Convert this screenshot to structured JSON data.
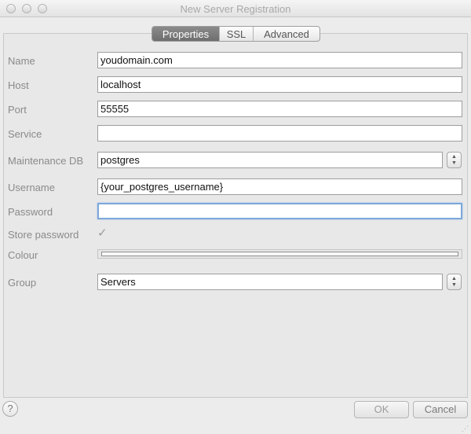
{
  "window": {
    "title": "New Server Registration"
  },
  "tabs": [
    {
      "label": "Properties",
      "active": true
    },
    {
      "label": "SSL",
      "active": false
    },
    {
      "label": "Advanced",
      "active": false
    }
  ],
  "form": {
    "name": {
      "label": "Name",
      "value": "youdomain.com"
    },
    "host": {
      "label": "Host",
      "value": "localhost"
    },
    "port": {
      "label": "Port",
      "value": "55555"
    },
    "service": {
      "label": "Service",
      "value": ""
    },
    "maintenance_db": {
      "label": "Maintenance DB",
      "value": "postgres"
    },
    "username": {
      "label": "Username",
      "value": "{your_postgres_username}"
    },
    "password": {
      "label": "Password",
      "value": ""
    },
    "store_password": {
      "label": "Store password",
      "checked": true
    },
    "colour": {
      "label": "Colour"
    },
    "group": {
      "label": "Group",
      "value": "Servers"
    }
  },
  "buttons": {
    "help": "?",
    "ok": "OK",
    "cancel": "Cancel"
  },
  "colors": {
    "focus_ring": "#7ea7d8",
    "active_tab": "#7a7a7a",
    "label": "#8a8a8a"
  }
}
